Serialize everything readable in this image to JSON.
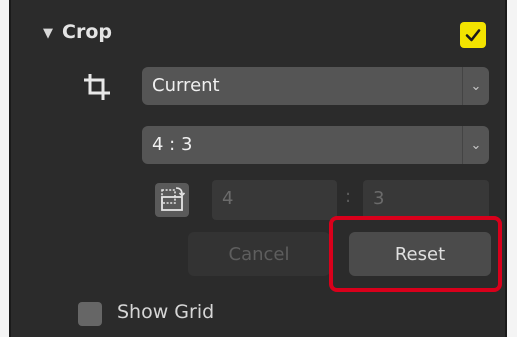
{
  "crop_section": {
    "toggle_glyph": "▼",
    "title": "Crop",
    "enabled": true,
    "check_glyph": "✓",
    "accent_color": "#f3e300",
    "preset_dropdown": {
      "value": "Current",
      "arrow": "⌄"
    },
    "ratio_dropdown": {
      "value": "4 : 3",
      "arrow": "⌄"
    },
    "ratio_width": "4",
    "ratio_separator": ":",
    "ratio_height": "3",
    "cancel_label": "Cancel",
    "reset_label": "Reset",
    "highlight_color": "#d9001b",
    "show_grid": {
      "label": "Show Grid",
      "checked": false
    }
  },
  "icons": {
    "crop": "crop-icon",
    "rotate_ratio": "rotate-ratio-icon",
    "section_toggle": "triangle-down-icon",
    "checkmark": "checkmark-icon"
  }
}
